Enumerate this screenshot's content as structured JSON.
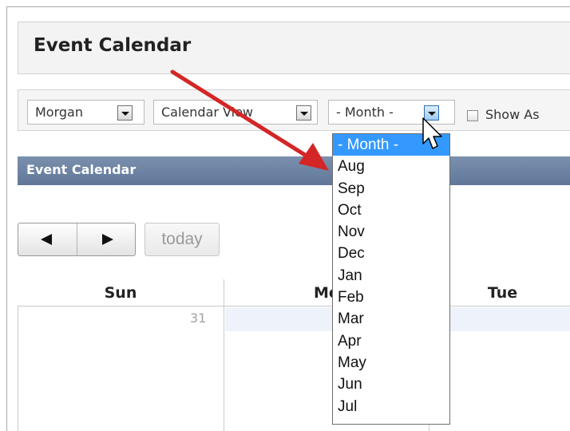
{
  "app": {
    "title": "Event Calendar"
  },
  "toolbar": {
    "location_value": "Morgan",
    "view_value": "Calendar View",
    "month_value": "- Month -",
    "show_checkbox_label": "Show As"
  },
  "section": {
    "title": "Event Calendar"
  },
  "nav": {
    "today_label": "today"
  },
  "calendar": {
    "day_headers": [
      "Sun",
      "Mo",
      "Tue"
    ],
    "first_date": "31"
  },
  "month_dropdown": {
    "options": [
      "- Month -",
      "Aug",
      "Sep",
      "Oct",
      "Nov",
      "Dec",
      "Jan",
      "Feb",
      "Mar",
      "Apr",
      "May",
      "Jun",
      "Jul"
    ],
    "selected_index": 0
  },
  "colors": {
    "accent": "#3399ff",
    "header_bar": "#6a809f",
    "annotation_arrow": "#d42626"
  }
}
